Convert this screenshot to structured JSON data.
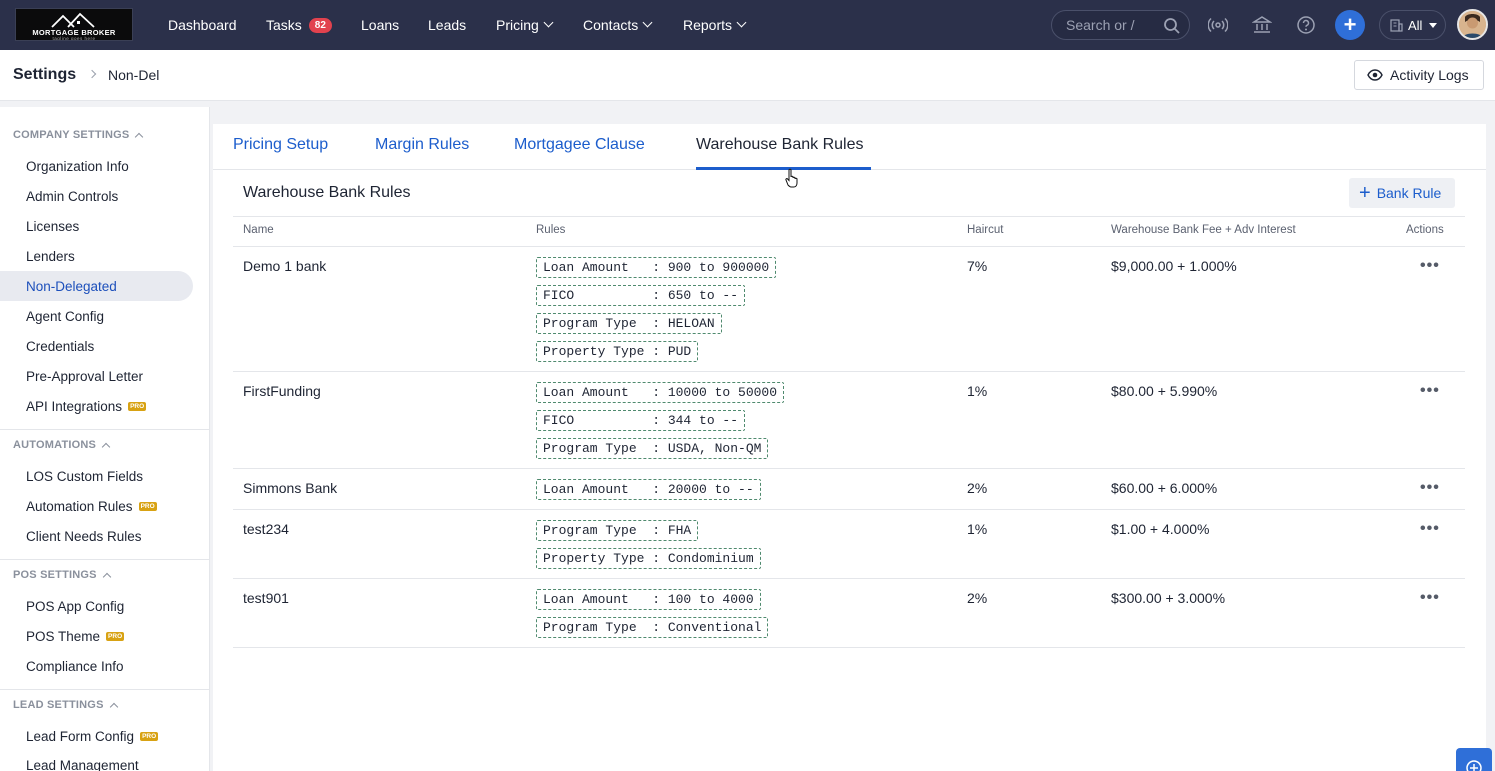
{
  "brand": {
    "logo_line1": "MORTGAGE BROKER",
    "logo_line2": "tagline goes here"
  },
  "topnav": {
    "items": [
      {
        "label": "Dashboard"
      },
      {
        "label": "Tasks",
        "badge": "82"
      },
      {
        "label": "Loans"
      },
      {
        "label": "Leads"
      },
      {
        "label": "Pricing"
      },
      {
        "label": "Contacts"
      },
      {
        "label": "Reports"
      }
    ],
    "search_placeholder": "Search or /",
    "scope_label": "All",
    "icons": [
      "broadcast-icon",
      "bank-icon",
      "help-icon",
      "add-icon",
      "building-icon",
      "avatar"
    ]
  },
  "breadcrumb": {
    "root": "Settings",
    "current": "Non-Del"
  },
  "header": {
    "activity_logs": "Activity Logs"
  },
  "sidebar": {
    "sections": [
      {
        "title": "COMPANY SETTINGS",
        "items": [
          "Organization Info",
          "Admin Controls",
          "Licenses",
          "Lenders",
          "Non-Delegated",
          "Agent Config",
          "Credentials",
          "Pre-Approval Letter",
          "API Integrations"
        ]
      },
      {
        "title": "AUTOMATIONS",
        "items": [
          "LOS Custom Fields",
          "Automation Rules",
          "Client Needs Rules"
        ]
      },
      {
        "title": "POS SETTINGS",
        "items": [
          "POS App Config",
          "POS Theme",
          "Compliance Info"
        ]
      },
      {
        "title": "LEAD SETTINGS",
        "items": [
          "Lead Form Config",
          "Lead Management"
        ]
      }
    ],
    "active": "Non-Delegated",
    "pro_label": "PRO"
  },
  "tabs": [
    "Pricing Setup",
    "Margin Rules",
    "Mortgagee Clause",
    "Warehouse Bank Rules"
  ],
  "active_tab": "Warehouse Bank Rules",
  "panel": {
    "title": "Warehouse Bank Rules",
    "add_button": "Bank Rule"
  },
  "table": {
    "columns": [
      "Name",
      "Rules",
      "Haircut",
      "Warehouse Bank Fee + Adv Interest",
      "Actions"
    ],
    "rows": [
      {
        "name": "Demo 1 bank",
        "rules": [
          "Loan Amount   : 900 to 900000",
          "FICO          : 650 to --",
          "Program Type  : HELOAN",
          "Property Type : PUD"
        ],
        "haircut": "7%",
        "fee": "$9,000.00 + 1.000%"
      },
      {
        "name": "FirstFunding",
        "rules": [
          "Loan Amount   : 10000 to 50000",
          "FICO          : 344 to --",
          "Program Type  : USDA, Non-QM"
        ],
        "haircut": "1%",
        "fee": "$80.00 + 5.990%"
      },
      {
        "name": "Simmons Bank",
        "rules": [
          "Loan Amount   : 20000 to --"
        ],
        "haircut": "2%",
        "fee": "$60.00 + 6.000%"
      },
      {
        "name": "test234",
        "rules": [
          "Program Type  : FHA",
          "Property Type : Condominium"
        ],
        "haircut": "1%",
        "fee": "$1.00 + 4.000%"
      },
      {
        "name": "test901",
        "rules": [
          "Loan Amount   : 100 to 4000",
          "Program Type  : Conventional"
        ],
        "haircut": "2%",
        "fee": "$300.00 + 3.000%"
      }
    ],
    "actions_label": "•••"
  }
}
